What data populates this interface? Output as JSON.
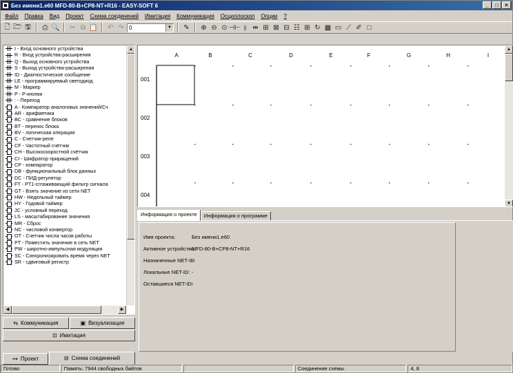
{
  "window": {
    "title": "Без имени1.e60 MFD-80-B+CP8-NT+R16 - EASY-SOFT 6",
    "controls": [
      "_",
      "□",
      "×"
    ]
  },
  "menu": [
    "Файл",
    "Правка",
    "Вид",
    "Проект",
    "Схема соединений",
    "Имитация",
    "Коммуникация",
    "Осциллоскоп",
    "Опции",
    "?"
  ],
  "toolbar": {
    "combo_value": "0"
  },
  "operands": [
    {
      "icon": "contact",
      "label": "I - Вход основного устройства"
    },
    {
      "icon": "contact",
      "label": "R - Вход устройства-расширения"
    },
    {
      "icon": "contact",
      "label": "Q - Выход основного устройства"
    },
    {
      "icon": "contact",
      "label": "S - Выход устройства-расширения"
    },
    {
      "icon": "contact",
      "label": "ID - Диагностическое сообщение"
    },
    {
      "icon": "contact",
      "label": "LE - программируемый светодиод"
    },
    {
      "icon": "contact",
      "label": "M - Маркер"
    },
    {
      "icon": "contact",
      "label": "P - P-кнопки"
    },
    {
      "icon": "contact",
      "label": ": - Переход"
    },
    {
      "icon": "block",
      "label": "A - Компаратор аналоговых значений/Сч"
    },
    {
      "icon": "block",
      "label": "AR - арифметика"
    },
    {
      "icon": "block",
      "label": "BC - сравнение блоков"
    },
    {
      "icon": "block",
      "label": "BT - перенос блока"
    },
    {
      "icon": "block",
      "label": "BV - логическая операция"
    },
    {
      "icon": "block",
      "label": "C - Счетчик-реле"
    },
    {
      "icon": "block",
      "label": "CF - Частотный счётчик"
    },
    {
      "icon": "block",
      "label": "CH - Высокоскоростной счётчик"
    },
    {
      "icon": "block",
      "label": "CI - Шифратор приращений"
    },
    {
      "icon": "block",
      "label": "CP - компаратор"
    },
    {
      "icon": "block",
      "label": "DB - функциональный блок данных"
    },
    {
      "icon": "block",
      "label": "DC - ПИД-регулятор"
    },
    {
      "icon": "block",
      "label": "FT - PT1-сглаживающий фильтр сигнала"
    },
    {
      "icon": "block",
      "label": "GT - Взять значение из сети NET"
    },
    {
      "icon": "block",
      "label": "HW - Недельный таймер"
    },
    {
      "icon": "block",
      "label": "HY - Годовой таймер"
    },
    {
      "icon": "block",
      "label": "JC - условный переход"
    },
    {
      "icon": "block",
      "label": "LS - масштабирование значения"
    },
    {
      "icon": "block",
      "label": "MR - Сброс"
    },
    {
      "icon": "block",
      "label": "NC - числовой конвертор"
    },
    {
      "icon": "block",
      "label": "OT - Счетчик числа часов работы"
    },
    {
      "icon": "block",
      "label": "PT - Поместить значение в сеть NET"
    },
    {
      "icon": "block",
      "label": "PW - широтно-импульсная модуляция"
    },
    {
      "icon": "block",
      "label": "SC - Синхронизировать время через NET"
    },
    {
      "icon": "block",
      "label": "SR - сдвиговый регистр"
    }
  ],
  "left_buttons": {
    "communication": "Коммуникация",
    "visualization": "Визуализация",
    "simulation": "Имитация",
    "project": "Проект",
    "circuit": "Схема соединений"
  },
  "diagram": {
    "columns": [
      "A",
      "B",
      "C",
      "D",
      "E",
      "F",
      "G",
      "H",
      "I"
    ],
    "rows": [
      "001",
      "002",
      "003",
      "004"
    ]
  },
  "info_tabs": [
    "Информация о проекте",
    "Информация о программе"
  ],
  "project_info": [
    {
      "label": "Имя проекта:",
      "value": "Без имени1.e60"
    },
    {
      "label": "Активное устройство:",
      "value": "MFD-80-B+CP8-NT+R16"
    },
    {
      "label": "Назначенные NET-ID:",
      "value": "-"
    },
    {
      "label": "Локальные NET-ID:",
      "value": "-"
    },
    {
      "label": "Оставшиеся NET-ID:",
      "value": "-"
    }
  ],
  "status": {
    "ready": "Готово",
    "memory": "Память: 7944 свободных байтов",
    "blank": "",
    "mode": "Соединение схемы",
    "pos": "4, 8"
  }
}
